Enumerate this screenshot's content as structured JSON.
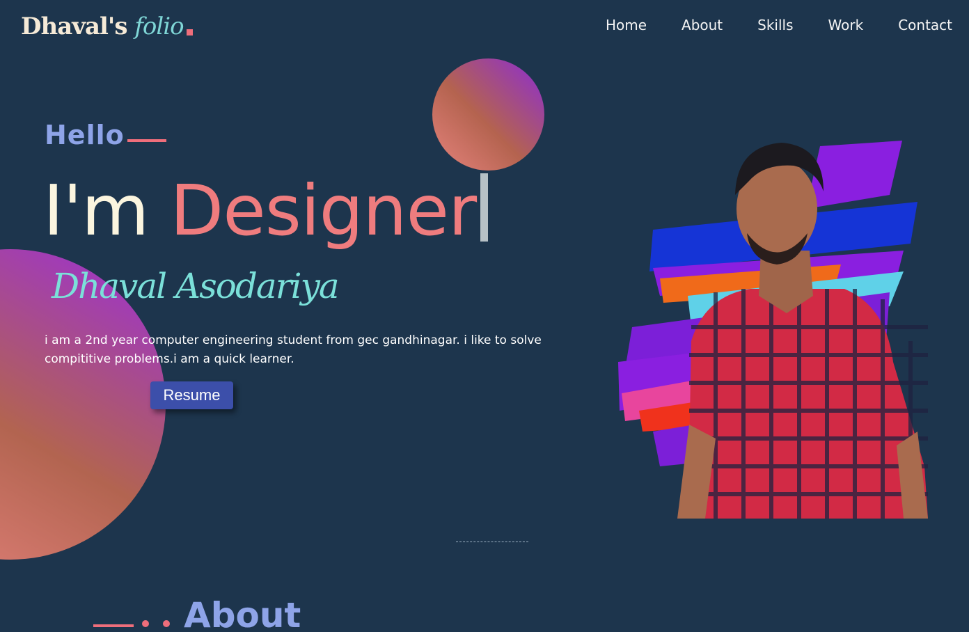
{
  "navbar": {
    "logo_part1": "Dhaval's",
    "logo_part2": "folio",
    "links": [
      "Home",
      "About",
      "Skills",
      "Work",
      "Contact"
    ]
  },
  "hero": {
    "greeting": "Hello",
    "headline_prefix": "I'm",
    "headline_role": "Designer",
    "signature": "Dhaval Asodariya",
    "bio": "i am a 2nd year computer engineering student from gec gandhinagar. i like to solve compititive problems.i am a quick learner.",
    "resume_label": "Resume"
  },
  "about": {
    "heading": "About"
  },
  "colors": {
    "background": "#1d354d",
    "accent_pink": "#ef6e7b",
    "accent_blue": "#8ea4e8",
    "accent_teal": "#7be0d9",
    "button": "#3c4faa"
  },
  "icons": {
    "portrait": "person-photo"
  }
}
